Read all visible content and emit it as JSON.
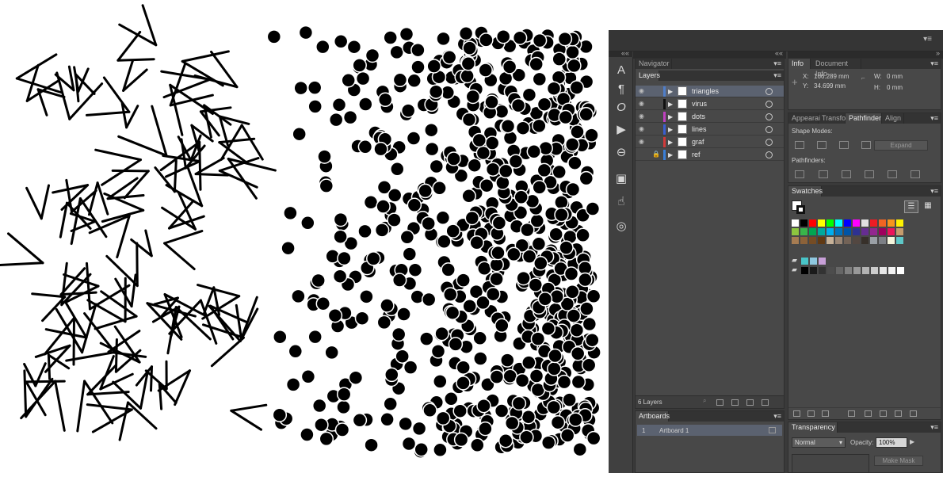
{
  "artwork": {
    "icons": [
      "lines-artwork",
      "dots-artwork"
    ]
  },
  "window": {
    "panel_menu_icon": "panel-menu-icon",
    "collapse_left": "««",
    "collapse_right": "»"
  },
  "tools": [
    "character-icon",
    "paragraph-icon",
    "opentype-icon",
    "play-icon",
    "links-icon",
    "artboard-tool-icon",
    "hand-pointer-icon",
    "creative-cloud-icon"
  ],
  "navigator_tab": "Navigator",
  "layers": {
    "tab": "Layers",
    "items": [
      {
        "name": "triangles",
        "color": "#4f7ec8",
        "selected": true,
        "locked": false
      },
      {
        "name": "virus",
        "color": "#111111",
        "selected": false,
        "locked": false
      },
      {
        "name": "dots",
        "color": "#c040c0",
        "selected": false,
        "locked": false
      },
      {
        "name": "lines",
        "color": "#3a5fd0",
        "selected": false,
        "locked": false
      },
      {
        "name": "graf",
        "color": "#d03a3a",
        "selected": false,
        "locked": false
      },
      {
        "name": "ref",
        "color": "#3a7fd8",
        "selected": false,
        "locked": true
      }
    ],
    "count": "6 Layers"
  },
  "artboards": {
    "tab": "Artboards",
    "items": [
      {
        "number": "1",
        "name": "Artboard 1"
      }
    ]
  },
  "info": {
    "tabs": [
      "Info",
      "Document Info"
    ],
    "x_label": "X:",
    "x_value": "166.289 mm",
    "y_label": "Y:",
    "y_value": "34.699 mm",
    "w_label": "W:",
    "w_value": "0 mm",
    "h_label": "H:",
    "h_value": "0 mm"
  },
  "pathfinder": {
    "tabs": [
      "Appearai",
      "Transfor",
      "Pathfinder",
      "Align"
    ],
    "shape_modes_label": "Shape Modes:",
    "expand_label": "Expand",
    "pathfinders_label": "Pathfinders:"
  },
  "swatches": {
    "tab": "Swatches",
    "row1": [
      "#ffffff",
      "#000000",
      "#ff0000",
      "#ffff00",
      "#00ff00",
      "#00ffff",
      "#0000ff",
      "#ff00ff",
      "#e0e0e0",
      "#ed1c24",
      "#f26522",
      "#f7941d",
      "#fff200"
    ],
    "row2": [
      "#8dc63f",
      "#39b54a",
      "#00a651",
      "#00a99d",
      "#00aeef",
      "#0072bc",
      "#0054a6",
      "#2e3192",
      "#662d91",
      "#92278f",
      "#9e005d",
      "#ed145b",
      "#c69c6d"
    ],
    "row3": [
      "#a67c52",
      "#8c6239",
      "#754c24",
      "#603913",
      "#c7b299",
      "#998675",
      "#736357",
      "#534741",
      "#37302a",
      "#9aa0a6",
      "#7d8086",
      "#f5f5dc",
      "#5ec8c8"
    ],
    "group1": [
      "#49c4c8",
      "#8fc8e0",
      "#c8a0d8"
    ],
    "grays": [
      "#000000",
      "#1a1a1a",
      "#333333",
      "#4d4d4d",
      "#666666",
      "#808080",
      "#999999",
      "#b3b3b3",
      "#cccccc",
      "#e6e6e6",
      "#f2f2f2",
      "#ffffff"
    ]
  },
  "transparency": {
    "tab": "Transparency",
    "mode": "Normal",
    "opacity_label": "Opacity:",
    "opacity_value": "100%",
    "make_mask": "Make Mask"
  }
}
